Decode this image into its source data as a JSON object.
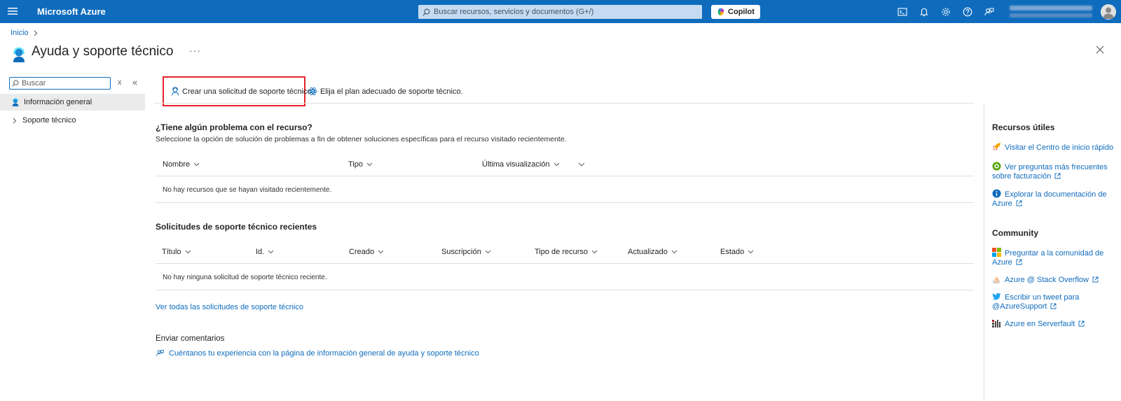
{
  "topbar": {
    "brand": "Microsoft Azure",
    "search_placeholder": "Buscar recursos, servicios y documentos (G+/)",
    "copilot_label": "Copilot",
    "bg_color": "#0f6cbd"
  },
  "breadcrumb": {
    "home": "Inicio"
  },
  "page": {
    "title": "Ayuda y soporte técnico",
    "more": "···"
  },
  "sidebar": {
    "search_placeholder": "Buscar",
    "clear": "x",
    "collapse": "«",
    "items": [
      {
        "label": "Información general",
        "active": true,
        "icon": "support-person-icon"
      },
      {
        "label": "Soporte técnico",
        "active": false,
        "icon": "chevron-right-icon"
      }
    ]
  },
  "commands": {
    "create_request": "Crear una solicitud de soporte técnico",
    "choose_plan": "Elija el plan adecuado de soporte técnico."
  },
  "resources_section": {
    "title": "¿Tiene algún problema con el recurso?",
    "subtitle": "Seleccione la opción de solución de problemas a fin de obtener soluciones específicas para el recurso visitado recientemente.",
    "columns": [
      "Nombre",
      "Tipo",
      "Última visualización"
    ],
    "empty": "No hay recursos que se hayan visitado recientemente."
  },
  "requests_section": {
    "title": "Solicitudes de soporte técnico recientes",
    "columns": [
      "Título",
      "Id.",
      "Creado",
      "Suscripción",
      "Tipo de recurso",
      "Actualizado",
      "Estado"
    ],
    "empty": "No hay ninguna solicitud de soporte técnico reciente.",
    "view_all": "Ver todas las solicitudes de soporte técnico"
  },
  "feedback_section": {
    "title": "Enviar comentarios",
    "link": "Cuéntanos tu experiencia con la página de información general de ayuda y soporte técnico"
  },
  "right_panel": {
    "useful_title": "Recursos útiles",
    "useful_links": [
      {
        "label": "Visitar el Centro de inicio rápido",
        "icon": "rocket-icon",
        "external": false
      },
      {
        "label": "Ver preguntas más frecuentes sobre facturación",
        "icon": "faq-icon",
        "external": true
      },
      {
        "label": "Explorar la documentación de Azure",
        "icon": "info-icon",
        "external": true
      }
    ],
    "community_title": "Community",
    "community_links": [
      {
        "label": "Preguntar a la comunidad de Azure",
        "icon": "microsoft-logo-icon",
        "external": true
      },
      {
        "label": "Azure @ Stack Overflow",
        "icon": "stack-overflow-icon",
        "external": true
      },
      {
        "label": "Escribir un tweet para @AzureSupport",
        "icon": "twitter-icon",
        "external": true
      },
      {
        "label": "Azure en Serverfault",
        "icon": "serverfault-icon",
        "external": true
      }
    ]
  }
}
